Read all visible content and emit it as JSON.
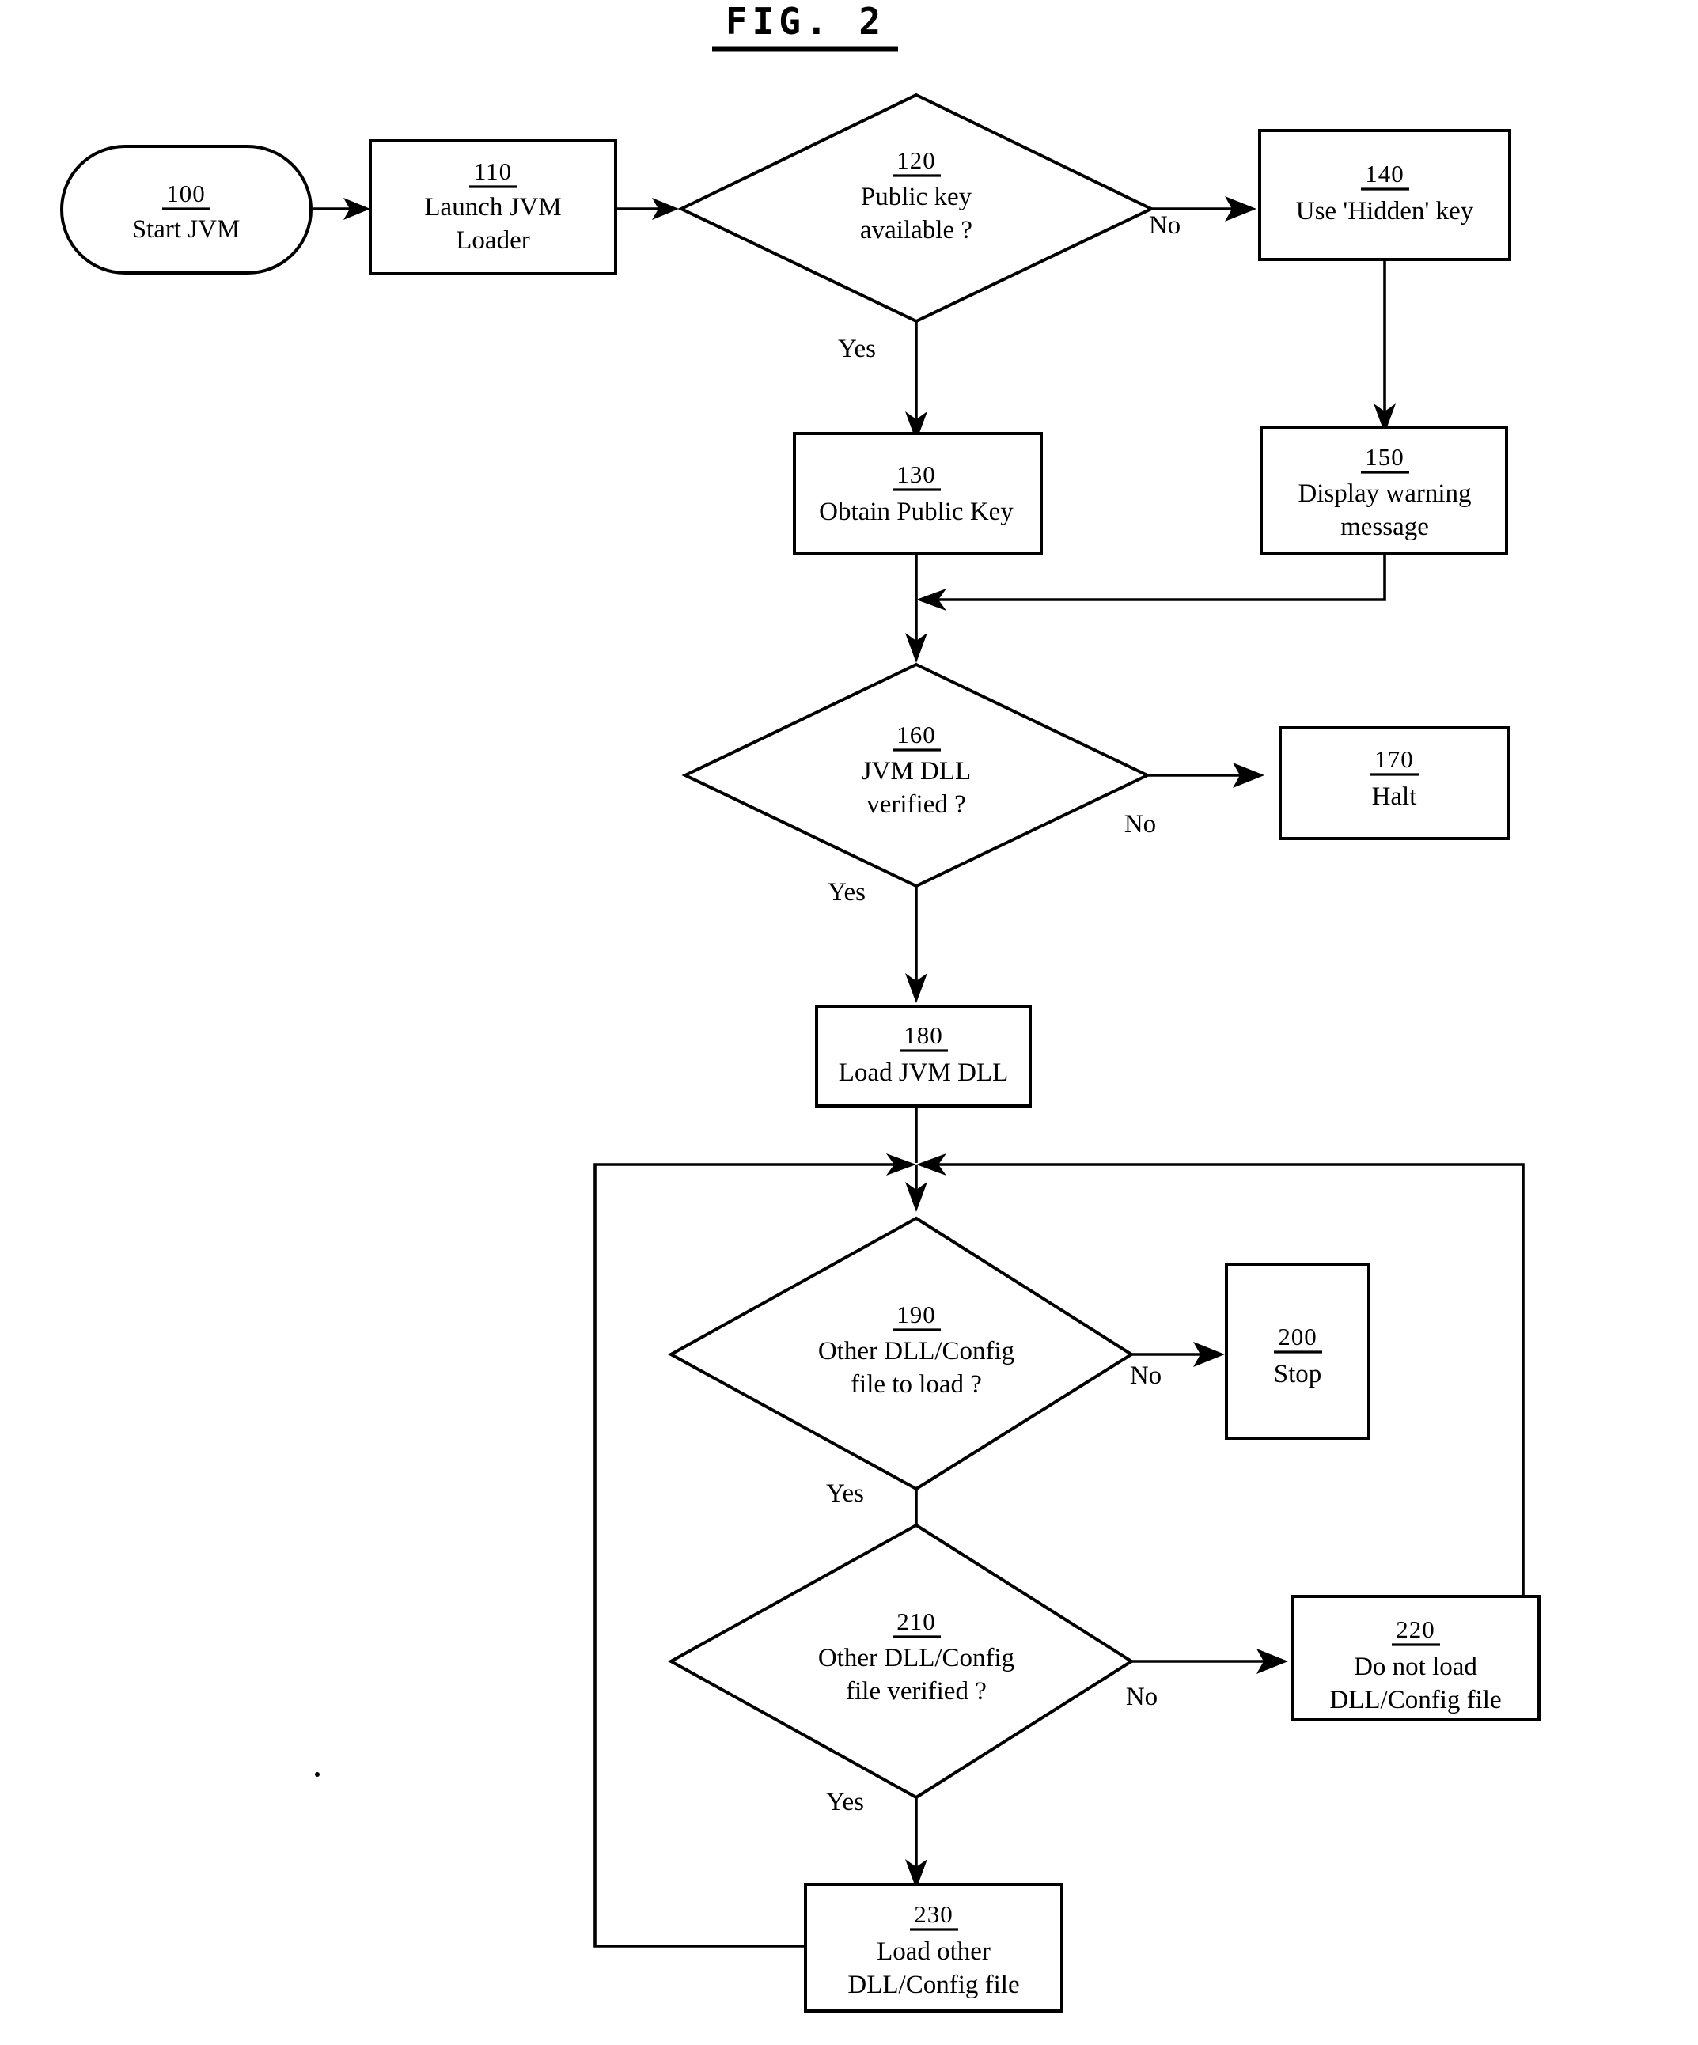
{
  "figure": {
    "title": "FIG. 2",
    "kind": "patent-flowchart"
  },
  "nodes": {
    "n100": {
      "id": "100",
      "line1": "Start JVM",
      "line2": "",
      "line3": "",
      "shape": "stadium"
    },
    "n110": {
      "id": "110",
      "line1": "Launch JVM",
      "line2": "Loader",
      "line3": "",
      "shape": "rect"
    },
    "n120": {
      "id": "120",
      "line1": "Public key",
      "line2": "available ?",
      "line3": "",
      "shape": "diamond"
    },
    "n140": {
      "id": "140",
      "line1": "Use 'Hidden' key",
      "line2": "",
      "line3": "",
      "shape": "rect"
    },
    "n130": {
      "id": "130",
      "line1": "Obtain Public Key",
      "line2": "",
      "line3": "",
      "shape": "rect"
    },
    "n150": {
      "id": "150",
      "line1": "Display warning",
      "line2": "message",
      "line3": "",
      "shape": "rect"
    },
    "n160": {
      "id": "160",
      "line1": "JVM DLL",
      "line2": "verified ?",
      "line3": "",
      "shape": "diamond"
    },
    "n170": {
      "id": "170",
      "line1": "Halt",
      "line2": "",
      "line3": "",
      "shape": "rect"
    },
    "n180": {
      "id": "180",
      "line1": "Load JVM DLL",
      "line2": "",
      "line3": "",
      "shape": "rect"
    },
    "n190": {
      "id": "190",
      "line1": "Other DLL/Config",
      "line2": "file to load ?",
      "line3": "",
      "shape": "diamond"
    },
    "n200": {
      "id": "200",
      "line1": "Stop",
      "line2": "",
      "line3": "",
      "shape": "rect"
    },
    "n210": {
      "id": "210",
      "line1": "Other DLL/Config",
      "line2": "file verified ?",
      "line3": "",
      "shape": "diamond"
    },
    "n220": {
      "id": "220",
      "line1": "Do not load",
      "line2": "DLL/Config file",
      "line3": "",
      "shape": "rect"
    },
    "n230": {
      "id": "230",
      "line1": "Load other",
      "line2": "DLL/Config file",
      "line3": "",
      "shape": "rect"
    }
  },
  "edge_labels": {
    "e120_no": "No",
    "e120_yes": "Yes",
    "e160_no": "No",
    "e160_yes": "Yes",
    "e190_no": "No",
    "e190_yes": "Yes",
    "e210_no": "No",
    "e210_yes": "Yes"
  },
  "colors": {
    "ink": "#000000",
    "paper": "#ffffff"
  }
}
